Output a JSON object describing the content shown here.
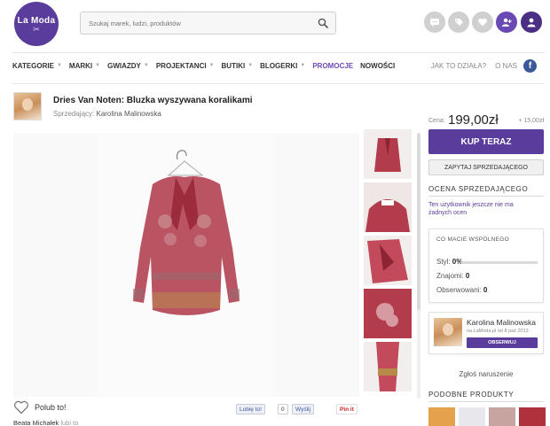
{
  "header": {
    "logo_text": "La Moda",
    "logo_mark": "✂",
    "search_placeholder": "Szukaj marek, ludzi, produktów"
  },
  "nav": {
    "items": [
      {
        "label": "KATEGORIE",
        "chevron": true,
        "active": false
      },
      {
        "label": "MARKI",
        "chevron": true,
        "active": false
      },
      {
        "label": "GWIAZDY",
        "chevron": true,
        "active": false
      },
      {
        "label": "PROJEKTANCI",
        "chevron": true,
        "active": false
      },
      {
        "label": "BUTIKI",
        "chevron": true,
        "active": false
      },
      {
        "label": "BLOGERKI",
        "chevron": true,
        "active": false
      },
      {
        "label": "PROMOCJE",
        "chevron": false,
        "active": true
      },
      {
        "label": "NOWOŚCI",
        "chevron": false,
        "active": false
      }
    ],
    "how_it_works": "JAK TO DZIAŁA?",
    "about": "O NAS",
    "fb_letter": "f"
  },
  "product": {
    "title": "Dries Van Noten: Bluzka wyszywana koralikami",
    "seller_label": "Sprzedający:",
    "seller_name": "Karolina Malinowska"
  },
  "social": {
    "like_label": "Polub to!",
    "liker_name": "Beata Michałek",
    "liker_tail": "lubi to",
    "fb_like": "Lubię to!",
    "fb_count": "0",
    "send": "Wyślij",
    "pin": "Pin it"
  },
  "purchase": {
    "price_label": "Cena:",
    "price_value": "199,00zł",
    "shipping": "+ 15,00zł",
    "buy_label": "KUP TERAZ",
    "ask_label": "ZAPYTAJ SPRZEDAJĄCEGO"
  },
  "rating": {
    "title": "OCENA SPRZEDAJĄCEGO",
    "note": "Ten użytkownik jeszcze nie ma żadnych ocen"
  },
  "common": {
    "title": "CO MACIE WSPÓLNEGO",
    "style_label": "Styl:",
    "style_value": "0%",
    "style_fraction": 0,
    "friends_label": "Znajomi:",
    "friends_value": "0",
    "followers_label": "Obserwowani:",
    "followers_value": "0"
  },
  "seller_card": {
    "name": "Karolina Malinowska",
    "since": "na LaModa.pl od 8 paź 2013",
    "follow_label": "OBSERWUJ"
  },
  "report_label": "Zgłoś naruszenie",
  "similar": {
    "title": "PODOBNE PRODUKTY"
  },
  "colors": {
    "brand": "#5a3c9c",
    "accent": "#6a49b5",
    "garment": "#b23c4c"
  }
}
